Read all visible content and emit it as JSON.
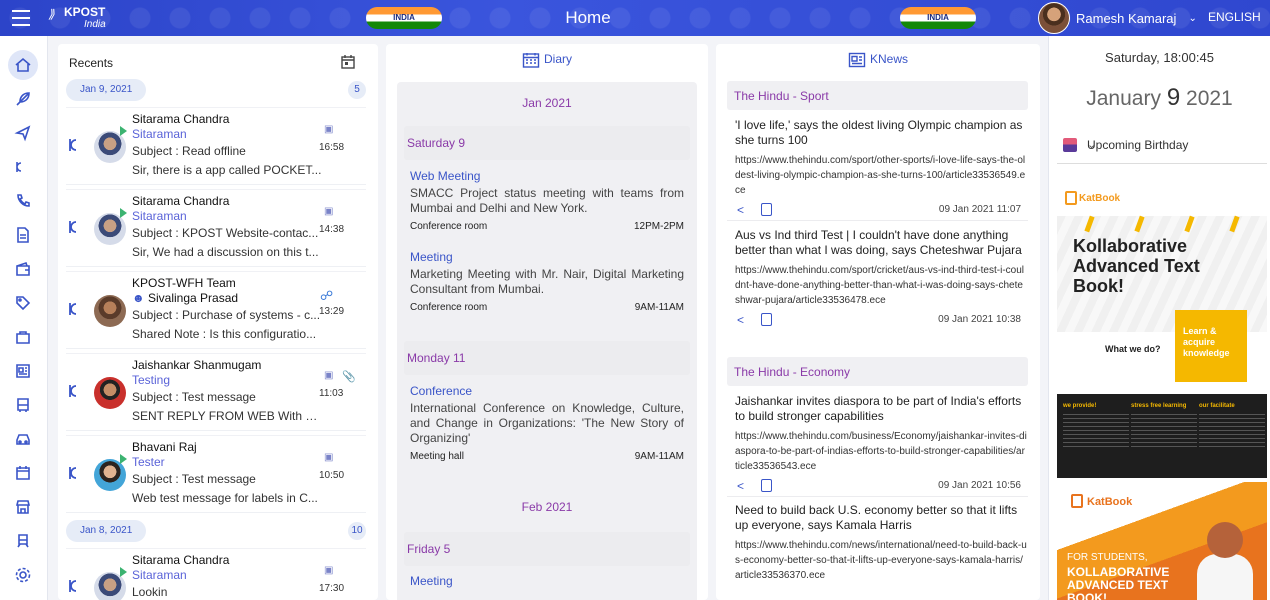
{
  "header": {
    "logo_text": "KPOST",
    "logo_sub": "India",
    "flag_text": "INDIA",
    "title": "Home",
    "user_name": "Ramesh Kamaraj",
    "language": "ENGLISH"
  },
  "nav_icons": [
    "home-icon",
    "feather-icon",
    "send-icon",
    "kpost-icon",
    "phone-icon",
    "document-icon",
    "wallet-icon",
    "tags-icon",
    "bag-icon",
    "news-icon",
    "bus-icon",
    "car-icon",
    "calendar-icon",
    "store-icon",
    "train-icon",
    "settings-icon"
  ],
  "recents": {
    "title": "Recents",
    "groups": [
      {
        "date": "Jan 9, 2021",
        "count": "5",
        "items": [
          {
            "line1": "Sitarama Chandra",
            "line2": "Sitaraman",
            "subject": "Subject : Read offline",
            "preview": "Sir, there is a app called POCKET...",
            "time": "16:58"
          },
          {
            "line1": "Sitarama Chandra",
            "line2": "Sitaraman",
            "subject": "Subject : KPOST Website-contac...",
            "preview": "Sir, We had a discussion on this t...",
            "time": "14:38"
          },
          {
            "line1": "KPOST-WFH Team",
            "line2": "Sivalinga Prasad",
            "subject": "Subject : Purchase of systems - c...",
            "preview": "Shared Note : Is this configuratio...",
            "time": "13:29"
          },
          {
            "line1": "Jaishankar Shanmugam",
            "line2": "Testing",
            "subject": "Subject : Test message",
            "preview": "SENT REPLY FROM WEB With a...",
            "time": "11:03"
          },
          {
            "line1": "Bhavani Raj",
            "line2": "Tester",
            "subject": "Subject : Test message",
            "preview": "Web test message for labels in C...",
            "time": "10:50"
          }
        ]
      },
      {
        "date": "Jan 8, 2021",
        "count": "10",
        "items": [
          {
            "line1": "Sitarama Chandra",
            "line2": "Sitaraman",
            "subject": "Lookin",
            "preview": "",
            "time": "17:30"
          }
        ]
      }
    ]
  },
  "diary": {
    "title": "Diary",
    "months": [
      {
        "label": "Jan 2021",
        "days": [
          {
            "label": "Saturday 9",
            "events": [
              {
                "title": "Web Meeting",
                "desc": "SMACC Project status meeting with teams from Mumbai and Delhi and New York.",
                "place": "Conference room",
                "time": "12PM-2PM"
              },
              {
                "title": "Meeting",
                "desc": "Marketing Meeting with Mr. Nair, Digital Marketing Consultant from Mumbai.",
                "place": "Conference room",
                "time": "9AM-11AM"
              }
            ]
          },
          {
            "label": "Monday 11",
            "events": [
              {
                "title": "Conference",
                "desc": "International Conference on Knowledge, Culture, and Change in Organizations: 'The New Story of Organizing'",
                "place": "Meeting hall",
                "time": "9AM-11AM"
              }
            ]
          }
        ]
      },
      {
        "label": "Feb 2021",
        "days": [
          {
            "label": "Friday 5",
            "events": [
              {
                "title": "Meeting"
              }
            ]
          }
        ]
      }
    ]
  },
  "knews": {
    "title": "KNews",
    "sources": [
      {
        "name": "The Hindu - Sport",
        "articles": [
          {
            "headline": "'I love life,' says the oldest living Olympic champion as she turns 100",
            "link": "https://www.thehindu.com/sport/other-sports/i-love-life-says-the-oldest-living-olympic-champion-as-she-turns-100/article33536549.ece",
            "date": "09 Jan 2021 11:07"
          },
          {
            "headline": "Aus vs Ind third Test | I couldn't have done anything better than what I was doing, says Cheteshwar Pujara",
            "link": "https://www.thehindu.com/sport/cricket/aus-vs-ind-third-test-i-couldnt-have-done-anything-better-than-what-i-was-doing-says-cheteshwar-pujara/article33536478.ece",
            "date": "09 Jan 2021 10:38"
          }
        ]
      },
      {
        "name": "The Hindu - Economy",
        "articles": [
          {
            "headline": "Jaishankar invites diaspora to be part of India's efforts to build stronger capabilities",
            "link": "https://www.thehindu.com/business/Economy/jaishankar-invites-diaspora-to-be-part-of-indias-efforts-to-build-stronger-capabilities/article33536543.ece",
            "date": "09 Jan 2021 10:56"
          },
          {
            "headline": "Need to build back U.S. economy better so that it lifts up everyone, says Kamala Harris",
            "link": "https://www.thehindu.com/news/international/need-to-build-back-us-economy-better-so-that-it-lifts-up-everyone-says-kamala-harris/article33536370.ece",
            "date": ""
          }
        ]
      }
    ]
  },
  "sidebar_right": {
    "clock": "Saturday, 18:00:45",
    "month": "January",
    "day": "9",
    "year": "2021",
    "birthday_label": "Upcoming Birthday",
    "ad1": {
      "brand": "KatBook",
      "headline": "Kollaborative Advanced Text Book!",
      "what": "What we do?",
      "learn": "Learn & acquire knowledge"
    },
    "ad2": {
      "c1": "we provide!",
      "c2": "stress free learning",
      "c3": "our facilitate"
    },
    "ad3": {
      "brand": "KatBook",
      "line1": "FOR STUDENTS,",
      "line2": "KOLLABORATIVE ADVANCED TEXT BOOK!"
    }
  }
}
